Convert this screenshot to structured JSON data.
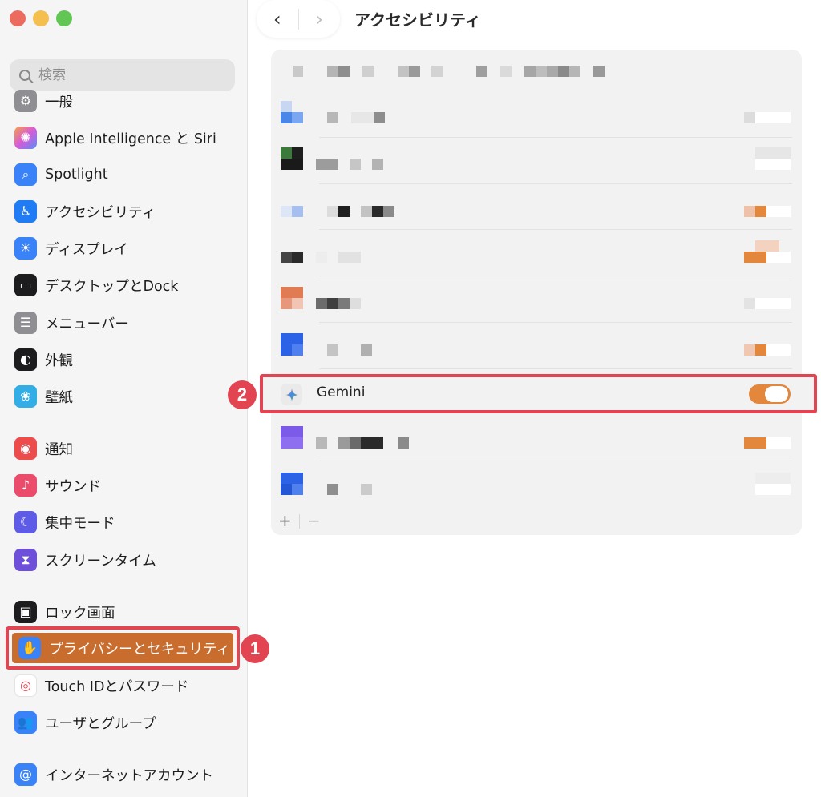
{
  "window": {
    "title": "アクセシビリティ"
  },
  "toolbar": {
    "back_glyph": "‹",
    "forward_glyph": "›"
  },
  "search": {
    "placeholder": "検索"
  },
  "sidebar": {
    "items": [
      {
        "label": "一般",
        "icon": "gear-icon",
        "color": "#8e8e93"
      },
      {
        "label": "Apple Intelligence と Siri",
        "icon": "siri-icon",
        "color": "#c86bd8"
      },
      {
        "label": "Spotlight",
        "icon": "magnifier-icon",
        "color": "#3a82f7"
      },
      {
        "label": "アクセシビリティ",
        "icon": "accessibility-icon",
        "color": "#1f7cf5"
      },
      {
        "label": "ディスプレイ",
        "icon": "sun-icon",
        "color": "#3a82f7"
      },
      {
        "label": "デスクトップとDock",
        "icon": "dock-icon",
        "color": "#1c1c1e"
      },
      {
        "label": "メニューバー",
        "icon": "menubar-icon",
        "color": "#8e8e93"
      },
      {
        "label": "外観",
        "icon": "appearance-icon",
        "color": "#1c1c1e"
      },
      {
        "label": "壁紙",
        "icon": "wallpaper-icon",
        "color": "#32ade6"
      },
      {
        "label": "通知",
        "icon": "bell-icon",
        "color": "#ec4c4b"
      },
      {
        "label": "サウンド",
        "icon": "speaker-icon",
        "color": "#ec4c6b"
      },
      {
        "label": "集中モード",
        "icon": "moon-icon",
        "color": "#5e5ce6"
      },
      {
        "label": "スクリーンタイム",
        "icon": "hourglass-icon",
        "color": "#6e4fd9"
      },
      {
        "label": "ロック画面",
        "icon": "lock-icon",
        "color": "#1c1c1e"
      },
      {
        "label": "プライバシーとセキュリティ",
        "icon": "hand-icon",
        "color": "#3a82f7"
      },
      {
        "label": "Touch IDとパスワード",
        "icon": "fingerprint-icon",
        "color": "#ffffff"
      },
      {
        "label": "ユーザとグループ",
        "icon": "users-icon",
        "color": "#3a82f7"
      },
      {
        "label": "インターネットアカウント",
        "icon": "at-icon",
        "color": "#3a82f7"
      }
    ]
  },
  "annotations": {
    "badge1": "1",
    "badge2": "2"
  },
  "panel": {
    "gemini": {
      "label": "Gemini",
      "toggle_on": true,
      "toggle_color": "#e3873c"
    },
    "footer": {
      "add": "+",
      "remove": "−"
    }
  }
}
